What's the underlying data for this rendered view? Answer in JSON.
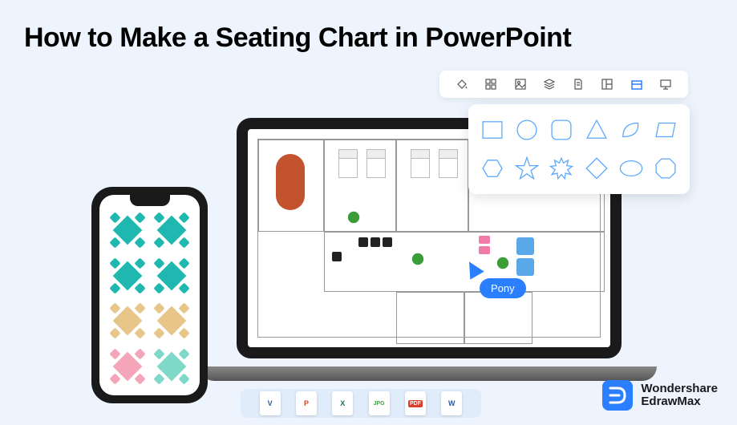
{
  "title": "How to Make a Seating Chart in PowerPoint",
  "cursor_label": "Pony",
  "toolbar_icons": [
    "fill",
    "apps",
    "image",
    "layers",
    "page",
    "layout",
    "block",
    "presentation"
  ],
  "shapes": [
    "rectangle",
    "circle",
    "rounded-square",
    "triangle",
    "leaf",
    "parallelogram",
    "hexagon",
    "star",
    "burst",
    "diamond",
    "ellipse",
    "octagon"
  ],
  "export_formats": [
    {
      "label": "V",
      "color": "#2b5797"
    },
    {
      "label": "P",
      "color": "#d24726"
    },
    {
      "label": "X",
      "color": "#217346"
    },
    {
      "label": "JPG",
      "color": "#4a9e4a"
    },
    {
      "label": "PDF",
      "color": "#e03e2d"
    },
    {
      "label": "W",
      "color": "#2b5797"
    }
  ],
  "logo": {
    "line1": "Wondershare",
    "line2": "EdrawMax"
  },
  "phone_tables": [
    "teal",
    "teal",
    "teal",
    "teal",
    "tan",
    "tan",
    "pink",
    "mint"
  ]
}
